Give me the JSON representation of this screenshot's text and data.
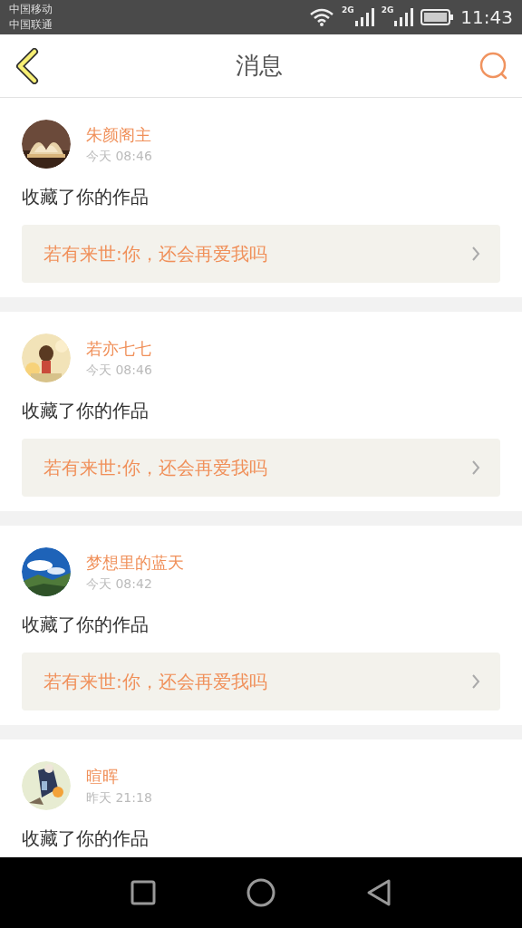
{
  "status_bar": {
    "carriers": [
      "中国移动",
      "中国联通"
    ],
    "networks": [
      "2G",
      "2G"
    ],
    "time": "11:43"
  },
  "header": {
    "title": "消息"
  },
  "messages": [
    {
      "name": "朱颜阁主",
      "time": "今天 08:46",
      "action": "收藏了你的作品",
      "link": "若有来世:你，还会再爱我吗"
    },
    {
      "name": "若亦七七",
      "time": "今天 08:46",
      "action": "收藏了你的作品",
      "link": "若有来世:你，还会再爱我吗"
    },
    {
      "name": "梦想里的蓝天",
      "time": "今天 08:42",
      "action": "收藏了你的作品",
      "link": "若有来世:你，还会再爱我吗"
    },
    {
      "name": "暄晖",
      "time": "昨天 21:18",
      "action": "收藏了你的作品"
    }
  ]
}
